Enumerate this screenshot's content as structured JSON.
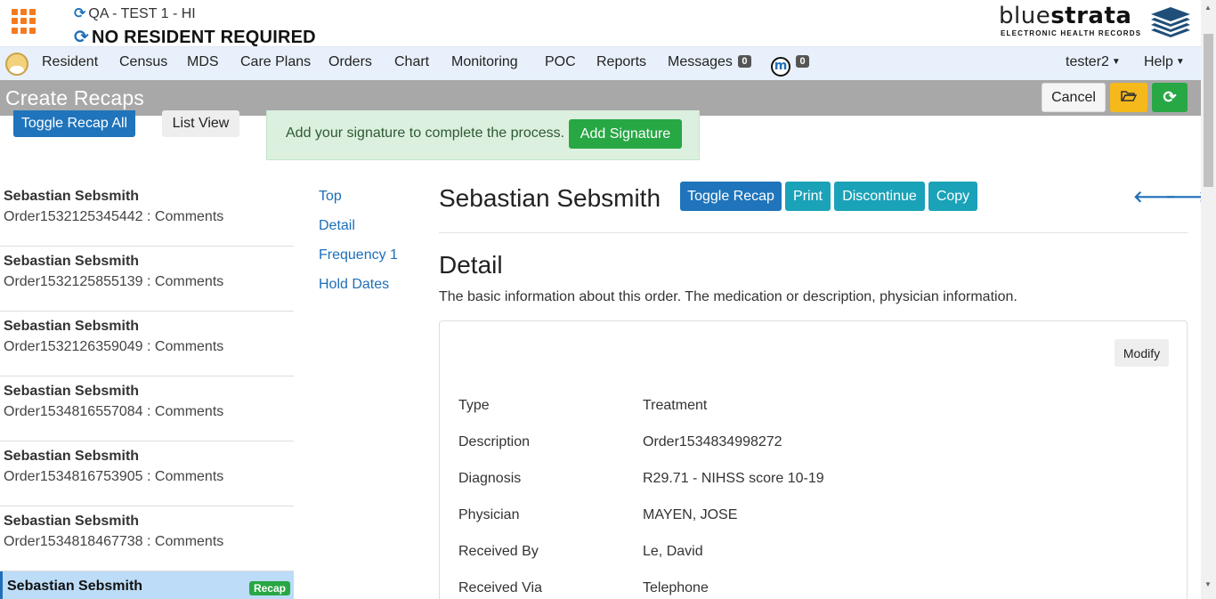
{
  "header": {
    "facility": "QA - TEST 1 - HI",
    "resident": "NO RESIDENT REQUIRED",
    "logo_light": "blue",
    "logo_bold": "strata",
    "logo_sub": "ELECTRONIC HEALTH RECORDS"
  },
  "nav": {
    "items": [
      "Resident",
      "Census",
      "MDS",
      "Care Plans",
      "Orders",
      "Chart",
      "Monitoring",
      "POC",
      "Reports",
      "Messages"
    ],
    "messages_count": "0",
    "m_icon_letter": "m",
    "m_count": "0",
    "user": "tester2",
    "help": "Help"
  },
  "titlebar": {
    "title": "Create Recaps",
    "cancel": "Cancel"
  },
  "toolbar": {
    "toggle_all": "Toggle Recap All",
    "list_view": "List View",
    "alert_text": "Add your signature to complete the process.",
    "add_signature": "Add Signature"
  },
  "orders": [
    {
      "name": "Sebastian Sebsmith",
      "order": "Order1532125345442 : Comments"
    },
    {
      "name": "Sebastian Sebsmith",
      "order": "Order1532125855139 : Comments"
    },
    {
      "name": "Sebastian Sebsmith",
      "order": "Order1532126359049 : Comments"
    },
    {
      "name": "Sebastian Sebsmith",
      "order": "Order1534816557084 : Comments"
    },
    {
      "name": "Sebastian Sebsmith",
      "order": "Order1534816753905 : Comments"
    },
    {
      "name": "Sebastian Sebsmith",
      "order": "Order1534818467738 : Comments"
    },
    {
      "name": "Sebastian Sebsmith",
      "badge": "Recap"
    }
  ],
  "section_nav": [
    "Top",
    "Detail",
    "Frequency 1",
    "Hold Dates"
  ],
  "main": {
    "name": "Sebastian Sebsmith",
    "toggle_recap": "Toggle Recap",
    "print": "Print",
    "discontinue": "Discontinue",
    "copy": "Copy",
    "section_title": "Detail",
    "section_desc": "The basic information about this order. The medication or description, physician information.",
    "modify": "Modify",
    "details": [
      {
        "label": "Type",
        "value": "Treatment"
      },
      {
        "label": "Description",
        "value": "Order1534834998272"
      },
      {
        "label": "Diagnosis",
        "value": "R29.71 - NIHSS score 10-19"
      },
      {
        "label": "Physician",
        "value": "MAYEN, JOSE"
      },
      {
        "label": "Received By",
        "value": "Le, David"
      },
      {
        "label": "Received Via",
        "value": "Telephone"
      }
    ]
  },
  "colors": {
    "primary": "#1f74bb",
    "info": "#1aa2b8",
    "success": "#28a745",
    "warning": "#f6b91b",
    "accent_orange": "#f47a20"
  }
}
